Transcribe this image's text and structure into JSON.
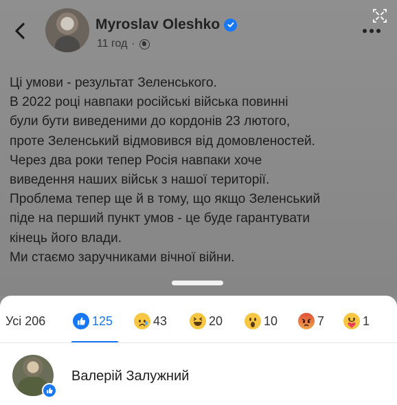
{
  "post": {
    "author": "Myroslav Oleshko",
    "time": "11 год",
    "separator": "·",
    "lines": [
      "Ці умови - результат Зеленського.",
      "В 2022 році навпаки російські війська повинні",
      "були бути виведеними до кордонів 23 лютого,",
      "проте Зеленський відмовився від домовленостей.",
      "Через два роки тепер Росія навпаки хоче",
      "виведення наших військ з нашої території.",
      "Проблема тепер ще й в тому, що якщо Зеленський",
      "піде на перший пункт умов - це буде гарантувати",
      "кінець його влади.",
      "Ми стаємо заручниками вічної війни."
    ]
  },
  "reactions": {
    "all_label": "Усі 206",
    "like": "125",
    "sad": "43",
    "haha": "20",
    "wow": "10",
    "angry": "7",
    "care": "1"
  },
  "reactor": {
    "name": "Валерій Залужний"
  },
  "colors": {
    "accent": "#1877f2"
  },
  "icons": [
    "back-arrow-icon",
    "expand-icon",
    "more-icon",
    "verified-icon",
    "globe-icon",
    "like-icon",
    "sad-icon",
    "haha-icon",
    "wow-icon",
    "angry-icon",
    "care-icon"
  ]
}
